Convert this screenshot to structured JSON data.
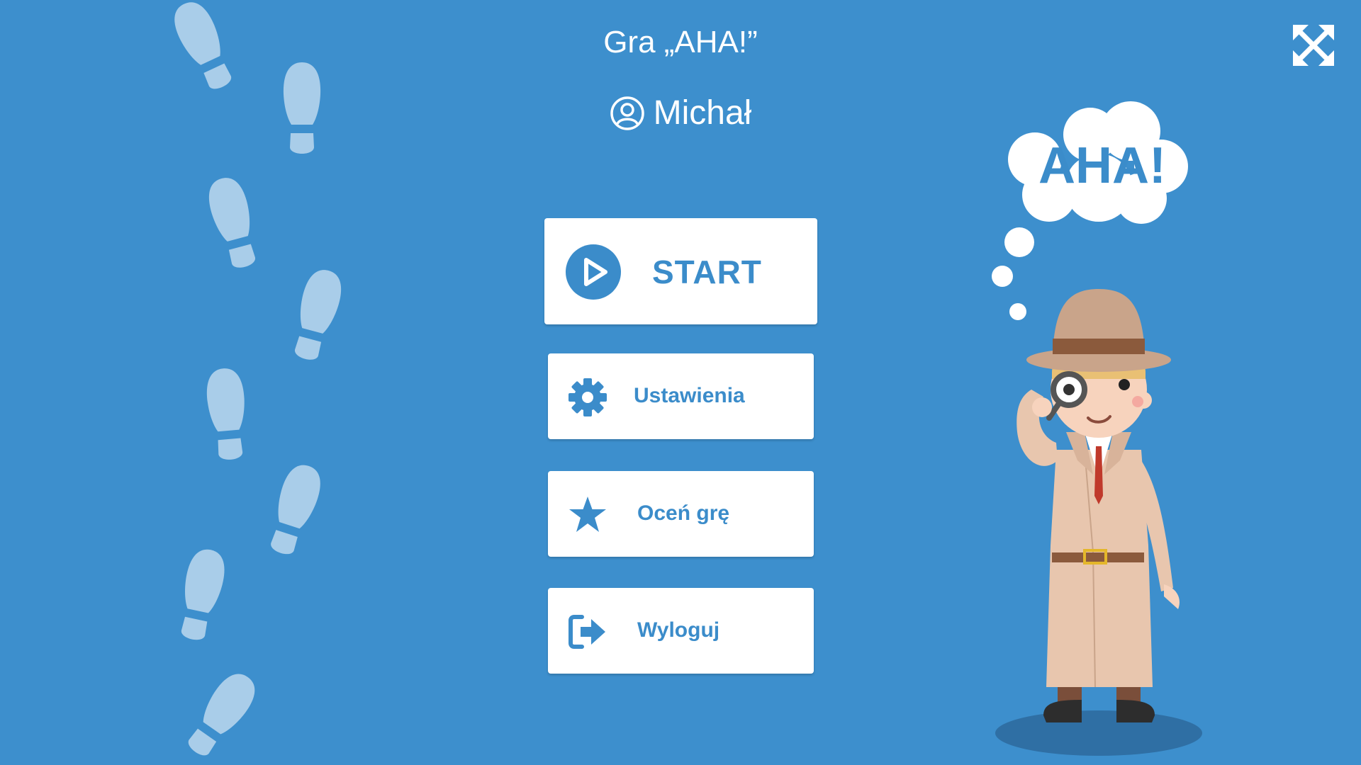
{
  "header": {
    "title": "Gra „AHA!”",
    "user_name": "Michał"
  },
  "menu": {
    "start_label": "START",
    "settings_label": "Ustawienia",
    "rate_label": "Oceń grę",
    "logout_label": "Wyloguj"
  },
  "illustration": {
    "thought_text": "AHA!"
  },
  "icons": {
    "fullscreen": "expand-arrows-icon",
    "user": "user-circle-icon",
    "start": "play-circle-icon",
    "settings": "gear-icon",
    "rate": "star-icon",
    "logout": "sign-out-icon"
  },
  "colors": {
    "background": "#3d8fcd",
    "accent": "#3b8cca",
    "button_bg": "#ffffff",
    "footprint": "#a9cde9"
  }
}
